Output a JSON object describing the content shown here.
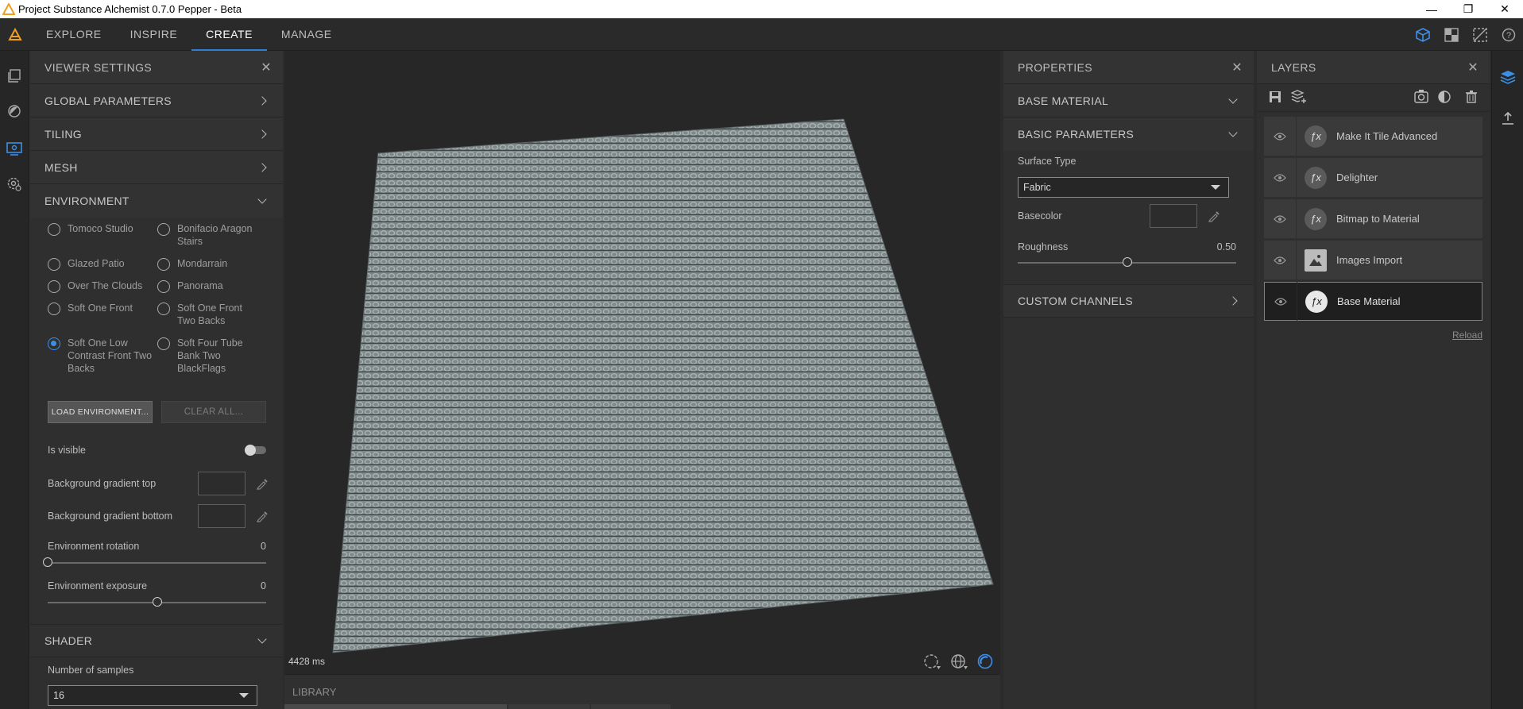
{
  "window": {
    "title": "Project Substance Alchemist 0.7.0 Pepper - Beta",
    "min": "—",
    "max": "❐",
    "close": "✕"
  },
  "nav": {
    "tabs": [
      "EXPLORE",
      "INSPIRE",
      "CREATE",
      "MANAGE"
    ],
    "active": "CREATE"
  },
  "viewer_settings": {
    "title": "VIEWER SETTINGS",
    "sections": {
      "global": "GLOBAL PARAMETERS",
      "tiling": "TILING",
      "mesh": "MESH",
      "environment": "ENVIRONMENT",
      "shader": "SHADER"
    },
    "environments": [
      {
        "label": "Tomoco Studio",
        "selected": false
      },
      {
        "label": "Bonifacio Aragon Stairs",
        "selected": false
      },
      {
        "label": "Glazed Patio",
        "selected": false
      },
      {
        "label": "Mondarrain",
        "selected": false
      },
      {
        "label": "Over The Clouds",
        "selected": false
      },
      {
        "label": "Panorama",
        "selected": false
      },
      {
        "label": "Soft One Front",
        "selected": false
      },
      {
        "label": "Soft One Front Two Backs",
        "selected": false
      },
      {
        "label": "Soft One Low Contrast Front Two Backs",
        "selected": true
      },
      {
        "label": "Soft Four Tube Bank Two BlackFlags",
        "selected": false
      }
    ],
    "load_env": "LOAD ENVIRONMENT...",
    "clear_all": "CLEAR ALL...",
    "is_visible": "Is visible",
    "is_visible_on": false,
    "bg_top": "Background gradient top",
    "bg_bottom": "Background gradient bottom",
    "env_rotation": {
      "label": "Environment rotation",
      "value": "0",
      "fraction": 0.0
    },
    "env_exposure": {
      "label": "Environment exposure",
      "value": "0",
      "fraction": 0.5
    },
    "samples": {
      "label": "Number of samples",
      "value": "16"
    }
  },
  "viewport": {
    "render_time": "4428 ms"
  },
  "library": {
    "title": "LIBRARY"
  },
  "properties": {
    "title": "PROPERTIES",
    "base_material": "BASE MATERIAL",
    "basic_parameters": "BASIC PARAMETERS",
    "surface_type": {
      "label": "Surface Type",
      "value": "Fabric"
    },
    "basecolor": "Basecolor",
    "roughness": {
      "label": "Roughness",
      "value": "0.50",
      "fraction": 0.5
    },
    "custom_channels": "CUSTOM CHANNELS"
  },
  "layers": {
    "title": "LAYERS",
    "items": [
      {
        "label": "Make It Tile Advanced",
        "icon": "fx-icon"
      },
      {
        "label": "Delighter",
        "icon": "fx-icon"
      },
      {
        "label": "Bitmap to Material",
        "icon": "fx-icon"
      },
      {
        "label": "Images Import",
        "icon": "image-icon"
      },
      {
        "label": "Base Material",
        "icon": "fx-icon",
        "selected": true
      }
    ],
    "reload": "Reload"
  },
  "colors": {
    "accent": "#3d8fe6",
    "logo": "#f0a020"
  }
}
